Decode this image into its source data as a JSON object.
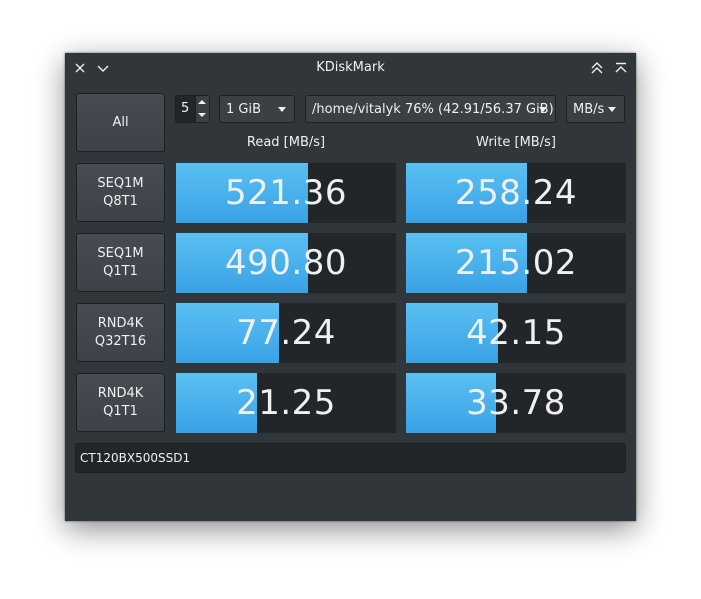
{
  "window": {
    "title": "KDiskMark"
  },
  "toolbar": {
    "all_label": "All",
    "count": "5",
    "size": "1 GiB",
    "path": "/home/vitalyk 76% (42.91/56.37 GiB)",
    "unit": "MB/s"
  },
  "headers": {
    "read": "Read [MB/s]",
    "write": "Write [MB/s]"
  },
  "tests": [
    {
      "label": "SEQ1M\nQ8T1",
      "read": "521.36",
      "write": "258.24",
      "read_fill": 0.6,
      "write_fill": 0.55
    },
    {
      "label": "SEQ1M\nQ1T1",
      "read": "490.80",
      "write": "215.02",
      "read_fill": 0.6,
      "write_fill": 0.55
    },
    {
      "label": "RND4K\nQ32T16",
      "read": "77.24",
      "write": "42.15",
      "read_fill": 0.47,
      "write_fill": 0.42
    },
    {
      "label": "RND4K\nQ1T1",
      "read": "21.25",
      "write": "33.78",
      "read_fill": 0.37,
      "write_fill": 0.41
    }
  ],
  "device": "CT120BX500SSD1",
  "colors": {
    "window_bg": "#31363b",
    "bar_fill": "#3daee9",
    "cell_bg": "#232629"
  }
}
